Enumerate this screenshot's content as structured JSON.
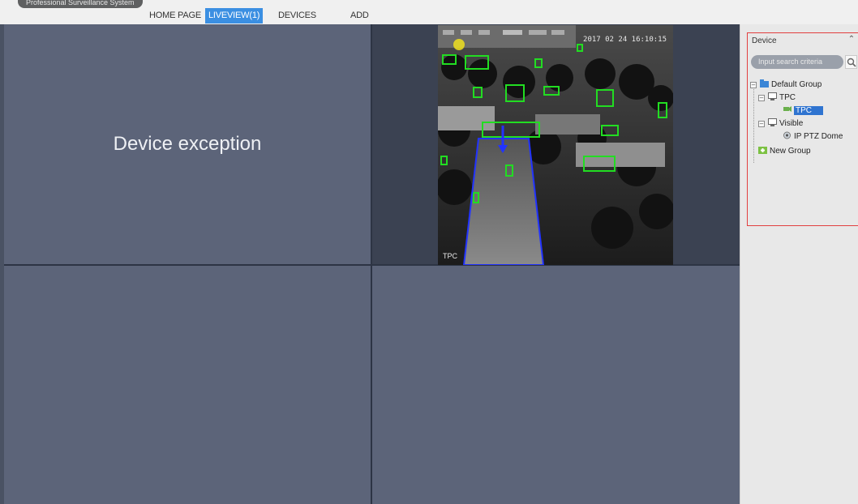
{
  "app": {
    "brand": "Professional Surveillance System"
  },
  "nav": {
    "items": [
      {
        "label": "HOME PAGE",
        "active": false
      },
      {
        "label": "LIVEVIEW(1)",
        "active": true
      },
      {
        "label": "DEVICES",
        "active": false
      },
      {
        "label": "ADD",
        "active": false
      }
    ]
  },
  "video": {
    "cell1_message": "Device exception",
    "feed": {
      "timestamp": "2017 02 24 16:10:15",
      "channel_label": "TPC",
      "detection_color": "#22dd22",
      "zone_color": "#2233ff"
    }
  },
  "device_panel": {
    "title": "Device",
    "search_placeholder": "Input search criteria",
    "tree": {
      "root": "Default Group",
      "tpc_group": "TPC",
      "tpc_device": "TPC",
      "visible_group": "Visible",
      "visible_device": "IP PTZ Dome",
      "new_group": "New Group"
    }
  },
  "colors": {
    "active_tab": "#3b8fe2",
    "highlight_frame": "#e24040",
    "selected_item": "#2f74d0"
  }
}
